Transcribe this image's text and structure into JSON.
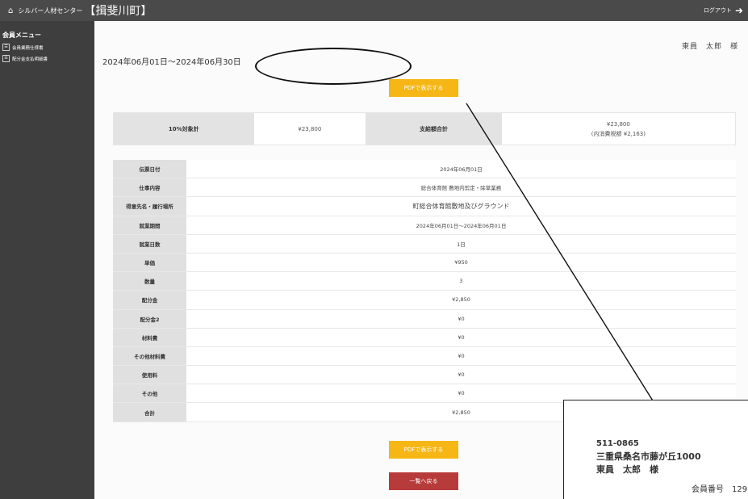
{
  "header": {
    "home_icon": "home-icon",
    "brand": "シルバー人材センター",
    "town": "【揖斐川町】",
    "logout_label": "ログアウト",
    "logout_icon": "logout-icon"
  },
  "sidebar": {
    "title": "会員メニュー",
    "items": [
      {
        "label": "会員業務仕様書",
        "icon": "document-icon"
      },
      {
        "label": "配分金支払明細書",
        "icon": "document-icon"
      }
    ]
  },
  "main": {
    "period": "2024年06月01日～2024年06月30日",
    "user_name": "東員　太郎　様",
    "pdf_button_label": "PDFで表示する",
    "back_button_label": "一覧へ戻る",
    "summary": {
      "taxable_label": "10%対象計",
      "taxable_value": "¥23,800",
      "total_label": "支給額合計",
      "total_value": "¥23,800",
      "tax_note": "(内消費税額 ¥2,163)"
    },
    "details": [
      {
        "label": "伝票日付",
        "value": "2024年06月01日"
      },
      {
        "label": "仕事内容",
        "value": "総合体育館 敷地内剪定・除草業務"
      },
      {
        "label": "得意先名・履行場所",
        "value": "町総合体育館敷地及びグラウンド"
      },
      {
        "label": "就業期間",
        "value": "2024年06月01日～2024年06月01日"
      },
      {
        "label": "就業日数",
        "value": "1日"
      },
      {
        "label": "単価",
        "value": "¥950"
      },
      {
        "label": "数量",
        "value": "3"
      },
      {
        "label": "配分金",
        "value": "¥2,850"
      },
      {
        "label": "配分金2",
        "value": "¥0"
      },
      {
        "label": "材料費",
        "value": "¥0"
      },
      {
        "label": "その他材料費",
        "value": "¥0"
      },
      {
        "label": "使用料",
        "value": "¥0"
      },
      {
        "label": "その他",
        "value": "¥0"
      },
      {
        "label": "合計",
        "value": "¥2,850"
      }
    ]
  },
  "card": {
    "postal": "511-0865",
    "address": "三重県桑名市藤が丘1000",
    "name": "東員　太郎　様",
    "member_label": "会員番号　129"
  },
  "colors": {
    "topbar": "#4a4a4a",
    "sidebar": "#3e3e3e",
    "pdf_button": "#f6b615",
    "back_button": "#b83b3b"
  }
}
